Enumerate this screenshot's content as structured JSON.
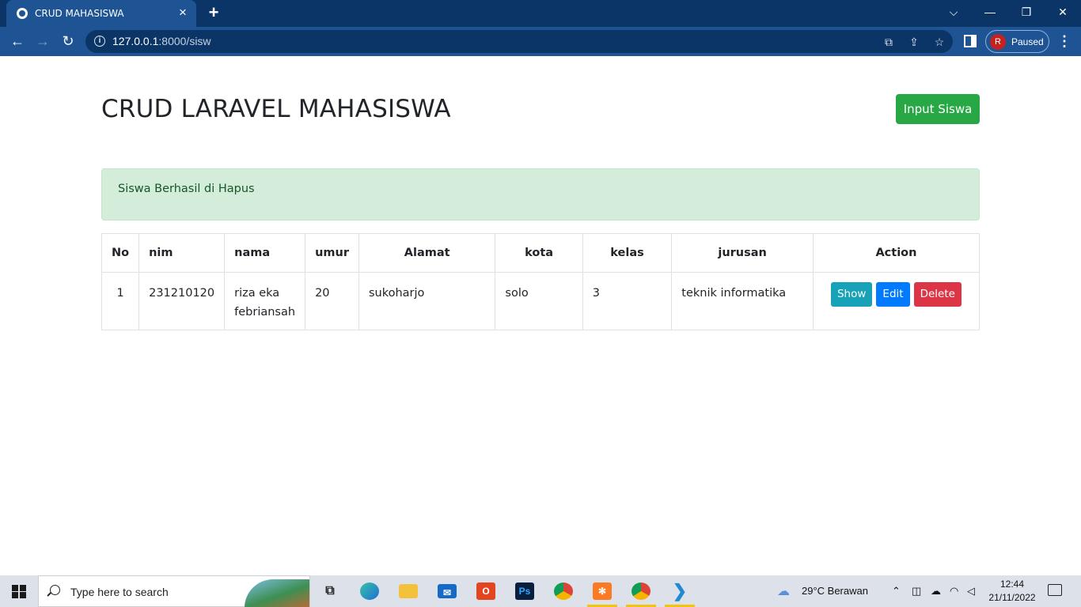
{
  "browser": {
    "tab_title": "CRUD MAHASISWA",
    "tab_close": "×",
    "new_tab": "+",
    "url_host": "127.0.0.1",
    "url_path": ":8000/sisw",
    "profile_initial": "R",
    "profile_status": "Paused",
    "window_controls": {
      "dropdown": "⌵",
      "minimize": "—",
      "restore": "❐",
      "close": "✕"
    },
    "nav": {
      "back": "←",
      "forward": "→",
      "reload": "↻"
    },
    "icons": [
      "translate-icon",
      "share-icon",
      "bookmark-star-icon",
      "side-panel-icon",
      "menu-icon"
    ]
  },
  "page": {
    "title": "CRUD LARAVEL MAHASISWA",
    "input_button": "Input Siswa",
    "alert": "Siswa Berhasil di Hapus",
    "table": {
      "headers": [
        "No",
        "nim",
        "nama",
        "umur",
        "Alamat",
        "kota",
        "kelas",
        "jurusan",
        "Action"
      ],
      "rows": [
        {
          "no": "1",
          "nim": "231210120",
          "nama": "riza eka febriansah",
          "umur": "20",
          "alamat": "sukoharjo",
          "kota": "solo",
          "kelas": "3",
          "jurusan": "teknik informatika",
          "actions": {
            "show": "Show",
            "edit": "Edit",
            "delete": "Delete"
          }
        }
      ]
    },
    "colors": {
      "success": "#28a745",
      "info": "#17a2b8",
      "primary": "#007bff",
      "danger": "#dc3545",
      "alert_bg": "#d4edda"
    }
  },
  "taskbar": {
    "search_placeholder": "Type here to search",
    "weather": "29°C  Berawan",
    "time": "12:44",
    "date": "21/11/2022",
    "apps": [
      "task-view-icon",
      "edge-icon",
      "file-explorer-icon",
      "mail-icon",
      "office-icon",
      "photoshop-icon",
      "chrome-icon",
      "xampp-icon",
      "chrome-profile-icon",
      "vscode-icon"
    ]
  }
}
